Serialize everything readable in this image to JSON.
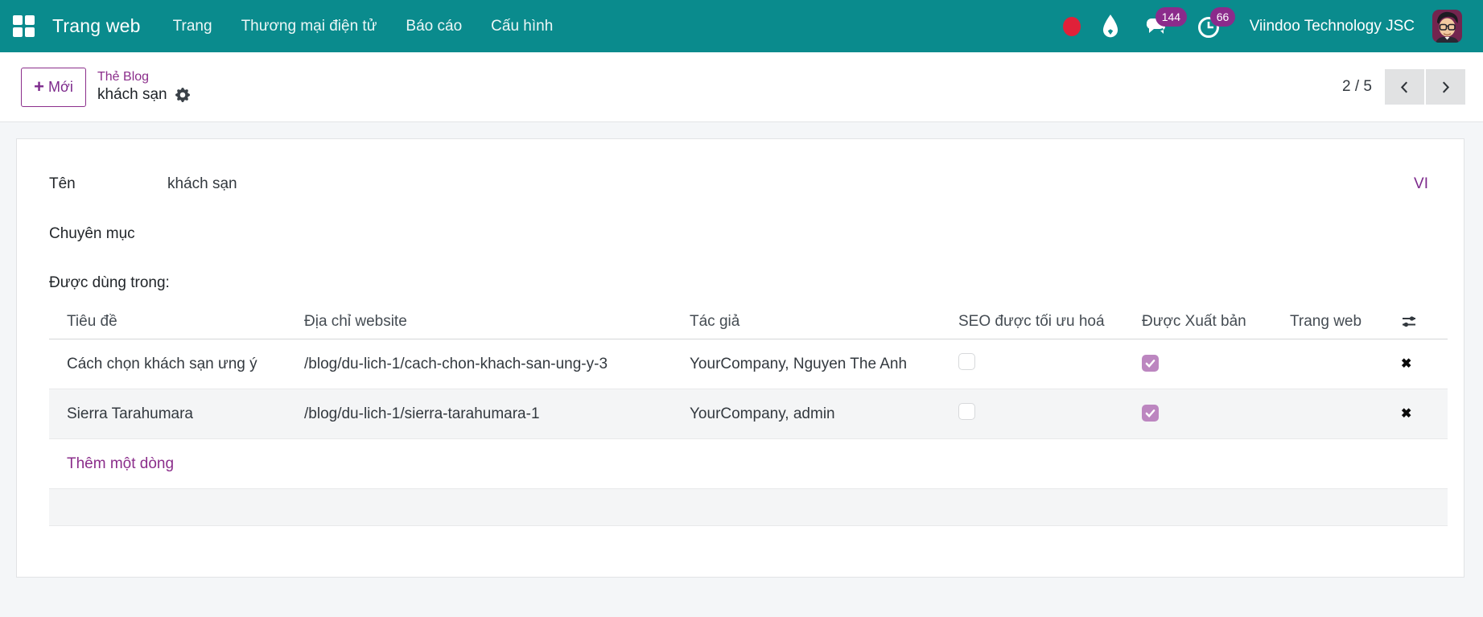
{
  "topbar": {
    "app_name": "Trang web",
    "menu_items": [
      {
        "label": "Trang"
      },
      {
        "label": "Thương mại điện tử"
      },
      {
        "label": "Báo cáo"
      },
      {
        "label": "Cấu hình"
      }
    ],
    "messages_count": "144",
    "activities_count": "66",
    "user_company": "Viindoo Technology JSC"
  },
  "control_panel": {
    "new_button_label": "Mới",
    "new_button_plus": "+",
    "breadcrumb_parent": "Thẻ Blog",
    "breadcrumb_current": "khách sạn",
    "pager_value": "2 / 5"
  },
  "form": {
    "fields": {
      "name_label": "Tên",
      "name_value": "khách sạn",
      "name_lang_badge": "VI",
      "category_label": "Chuyên mục",
      "category_value": "",
      "used_in_label": "Được dùng trong:"
    },
    "table": {
      "headers": [
        "Tiêu đề",
        "Địa chỉ website",
        "Tác giả",
        "SEO được tối ưu hoá",
        "Được Xuất bản",
        "Trang web"
      ],
      "rows": [
        {
          "title": "Cách chọn khách sạn ưng ý",
          "url": "/blog/du-lich-1/cach-chon-khach-san-ung-y-3",
          "author": "YourCompany, Nguyen The Anh",
          "seo_optimized": false,
          "published": true,
          "website": "",
          "delete_glyph": "✖"
        },
        {
          "title": "Sierra Tarahumara",
          "url": "/blog/du-lich-1/sierra-tarahumara-1",
          "author": "YourCompany, admin",
          "seo_optimized": false,
          "published": true,
          "website": "",
          "delete_glyph": "✖"
        }
      ],
      "add_line_label": "Thêm một dòng"
    }
  },
  "icons": {
    "apps_grid": "2x2 white squares",
    "record_indicator": "red filled circle",
    "droplet": "white water drop",
    "messages": "chat bubbles with count badge",
    "activities": "clock with count badge",
    "action_gear": "gear / cog menu",
    "pager_prev": "chevron left",
    "pager_next": "chevron right",
    "optional_columns": "horizontal sliders",
    "delete_row": "bold x cross"
  },
  "colors": {
    "topbar_teal": "#0a8b8d",
    "accent_purple": "#8b2e8b",
    "badge_purple": "#8b2b8b",
    "checkbox_checked": "#bc86c0",
    "notification_red": "#e02139",
    "page_background": "#f4f6f8"
  }
}
